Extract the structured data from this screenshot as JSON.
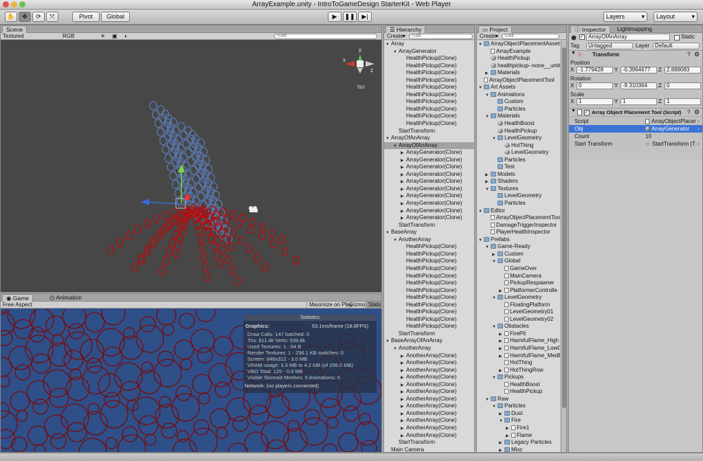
{
  "window": {
    "title": "ArrayExample.unity - IntroToGameDesign StarterKit - Web Player"
  },
  "toolbar": {
    "pivot": "Pivot",
    "global": "Global",
    "layers": "Layers",
    "layout": "Layout"
  },
  "scene": {
    "tab": "Scene",
    "shading": "Textured",
    "render": "RGB",
    "iso": "Iso",
    "axis_y": "y",
    "axis_x": "x",
    "axis_z": "z"
  },
  "game": {
    "tab": "Game",
    "tab2": "Animation",
    "aspect": "Free Aspect",
    "maximize": "Maximize on Play",
    "gizmos": "Gizmos",
    "stats": "Stats"
  },
  "stats": {
    "title": "Statistics",
    "graphics": "Graphics:",
    "frame": "53.1ms/frame (18.8FPS)",
    "lines": [
      "Draw Calls: 147  batched: 0",
      "Tris: 811.4k   Verts: 539.8k",
      "Used Textures: 1 - 64 B",
      "Render Textures: 1 - 256.1 KB  switches: 0",
      "Screen: 846x312 - 3.0 MB",
      "VRAM usage: 3.3 MB to 4.2 MB (of 256.0 MB)",
      "VBO Total: 125 - 0.9 MB",
      "Visible Skinned Meshes: 0     Animations: 0"
    ],
    "network": "Network: (no players connected)"
  },
  "hierarchy": {
    "tab": "Hierarchy",
    "create": "Create",
    "rows": [
      {
        "t": "Array",
        "d": 0,
        "a": "▼"
      },
      {
        "t": "ArrayGenerator",
        "d": 1,
        "a": "▼"
      },
      {
        "t": "HealthPickup(Clone)",
        "d": 2,
        "a": ""
      },
      {
        "t": "HealthPickup(Clone)",
        "d": 2,
        "a": ""
      },
      {
        "t": "HealthPickup(Clone)",
        "d": 2,
        "a": ""
      },
      {
        "t": "HealthPickup(Clone)",
        "d": 2,
        "a": ""
      },
      {
        "t": "HealthPickup(Clone)",
        "d": 2,
        "a": ""
      },
      {
        "t": "HealthPickup(Clone)",
        "d": 2,
        "a": ""
      },
      {
        "t": "HealthPickup(Clone)",
        "d": 2,
        "a": ""
      },
      {
        "t": "HealthPickup(Clone)",
        "d": 2,
        "a": ""
      },
      {
        "t": "HealthPickup(Clone)",
        "d": 2,
        "a": ""
      },
      {
        "t": "HealthPickup(Clone)",
        "d": 2,
        "a": ""
      },
      {
        "t": "StartTransform",
        "d": 1,
        "a": ""
      },
      {
        "t": "ArrayOfAnArray",
        "d": 0,
        "a": "▼"
      },
      {
        "t": "ArrayOfAnArray",
        "d": 1,
        "a": "▼",
        "sel": true
      },
      {
        "t": "ArrayGenerator(Clone)",
        "d": 2,
        "a": "▶"
      },
      {
        "t": "ArrayGenerator(Clone)",
        "d": 2,
        "a": "▶"
      },
      {
        "t": "ArrayGenerator(Clone)",
        "d": 2,
        "a": "▶"
      },
      {
        "t": "ArrayGenerator(Clone)",
        "d": 2,
        "a": "▶"
      },
      {
        "t": "ArrayGenerator(Clone)",
        "d": 2,
        "a": "▶"
      },
      {
        "t": "ArrayGenerator(Clone)",
        "d": 2,
        "a": "▶"
      },
      {
        "t": "ArrayGenerator(Clone)",
        "d": 2,
        "a": "▶"
      },
      {
        "t": "ArrayGenerator(Clone)",
        "d": 2,
        "a": "▶"
      },
      {
        "t": "ArrayGenerator(Clone)",
        "d": 2,
        "a": "▶"
      },
      {
        "t": "ArrayGenerator(Clone)",
        "d": 2,
        "a": "▶"
      },
      {
        "t": "StartTransform",
        "d": 1,
        "a": ""
      },
      {
        "t": "BaseArray",
        "d": 0,
        "a": "▼"
      },
      {
        "t": "AnotherArray",
        "d": 1,
        "a": "▼"
      },
      {
        "t": "HealthPickup(Clone)",
        "d": 2,
        "a": ""
      },
      {
        "t": "HealthPickup(Clone)",
        "d": 2,
        "a": ""
      },
      {
        "t": "HealthPickup(Clone)",
        "d": 2,
        "a": ""
      },
      {
        "t": "HealthPickup(Clone)",
        "d": 2,
        "a": ""
      },
      {
        "t": "HealthPickup(Clone)",
        "d": 2,
        "a": ""
      },
      {
        "t": "HealthPickup(Clone)",
        "d": 2,
        "a": ""
      },
      {
        "t": "HealthPickup(Clone)",
        "d": 2,
        "a": ""
      },
      {
        "t": "HealthPickup(Clone)",
        "d": 2,
        "a": ""
      },
      {
        "t": "HealthPickup(Clone)",
        "d": 2,
        "a": ""
      },
      {
        "t": "HealthPickup(Clone)",
        "d": 2,
        "a": ""
      },
      {
        "t": "HealthPickup(Clone)",
        "d": 2,
        "a": ""
      },
      {
        "t": "HealthPickup(Clone)",
        "d": 2,
        "a": ""
      },
      {
        "t": "StartTransform",
        "d": 1,
        "a": ""
      },
      {
        "t": "BaseArrayOfAnArray",
        "d": 0,
        "a": "▼"
      },
      {
        "t": "AnotherArray",
        "d": 1,
        "a": "▼"
      },
      {
        "t": "AnotherArray(Clone)",
        "d": 2,
        "a": "▶"
      },
      {
        "t": "AnotherArray(Clone)",
        "d": 2,
        "a": "▶"
      },
      {
        "t": "AnotherArray(Clone)",
        "d": 2,
        "a": "▶"
      },
      {
        "t": "AnotherArray(Clone)",
        "d": 2,
        "a": "▶"
      },
      {
        "t": "AnotherArray(Clone)",
        "d": 2,
        "a": "▶"
      },
      {
        "t": "AnotherArray(Clone)",
        "d": 2,
        "a": "▶"
      },
      {
        "t": "AnotherArray(Clone)",
        "d": 2,
        "a": "▶"
      },
      {
        "t": "AnotherArray(Clone)",
        "d": 2,
        "a": "▶"
      },
      {
        "t": "AnotherArray(Clone)",
        "d": 2,
        "a": "▶"
      },
      {
        "t": "AnotherArray(Clone)",
        "d": 2,
        "a": "▶"
      },
      {
        "t": "AnotherArray(Clone)",
        "d": 2,
        "a": "▶"
      },
      {
        "t": "AnotherArray(Clone)",
        "d": 2,
        "a": "▶"
      },
      {
        "t": "StartTransform",
        "d": 1,
        "a": ""
      },
      {
        "t": "Main Camera",
        "d": 0,
        "a": ""
      }
    ]
  },
  "project": {
    "tab": "Project",
    "create": "Create",
    "rows": [
      {
        "t": "ArrayObjectPlacementAssets",
        "d": 0,
        "a": "▼",
        "i": "folder"
      },
      {
        "t": "ArrayExample",
        "d": 1,
        "a": "",
        "i": "file"
      },
      {
        "t": "HealthPickup",
        "d": 1,
        "a": "",
        "i": "sphere"
      },
      {
        "t": "healthpickup--none__untit",
        "d": 1,
        "a": "",
        "i": "sphere"
      },
      {
        "t": "Materials",
        "d": 1,
        "a": "▶",
        "i": "folder"
      },
      {
        "t": "ArrayObjectPlacementTool",
        "d": 0,
        "a": "",
        "i": "file"
      },
      {
        "t": "Art Assets",
        "d": 0,
        "a": "▼",
        "i": "folder"
      },
      {
        "t": "Animations",
        "d": 1,
        "a": "▼",
        "i": "folder"
      },
      {
        "t": "Custom",
        "d": 2,
        "a": "",
        "i": "folder"
      },
      {
        "t": "Particles",
        "d": 2,
        "a": "",
        "i": "folder"
      },
      {
        "t": "Materials",
        "d": 1,
        "a": "▼",
        "i": "folder"
      },
      {
        "t": "HealthBoost",
        "d": 2,
        "a": "",
        "i": "sphere"
      },
      {
        "t": "HealthPickup",
        "d": 2,
        "a": "",
        "i": "sphere"
      },
      {
        "t": "LevelGeometry",
        "d": 2,
        "a": "▼",
        "i": "folder"
      },
      {
        "t": "HotThing",
        "d": 3,
        "a": "",
        "i": "sphere"
      },
      {
        "t": "LevelGeometry",
        "d": 3,
        "a": "",
        "i": "sphere"
      },
      {
        "t": "Particles",
        "d": 2,
        "a": "",
        "i": "folder"
      },
      {
        "t": "Test",
        "d": 2,
        "a": "",
        "i": "folder"
      },
      {
        "t": "Models",
        "d": 1,
        "a": "▶",
        "i": "folder"
      },
      {
        "t": "Shaders",
        "d": 1,
        "a": "▶",
        "i": "folder"
      },
      {
        "t": "Textures",
        "d": 1,
        "a": "▼",
        "i": "folder"
      },
      {
        "t": "LevelGeometry",
        "d": 2,
        "a": "",
        "i": "folder"
      },
      {
        "t": "Particles",
        "d": 2,
        "a": "",
        "i": "folder"
      },
      {
        "t": "Editor",
        "d": 0,
        "a": "▼",
        "i": "folder"
      },
      {
        "t": "ArrayObjectPlacementToo",
        "d": 1,
        "a": "",
        "i": "file"
      },
      {
        "t": "DamageTriggerInspector",
        "d": 1,
        "a": "",
        "i": "file"
      },
      {
        "t": "PlayerHealthInspector",
        "d": 1,
        "a": "",
        "i": "file"
      },
      {
        "t": "Prefabs",
        "d": 0,
        "a": "▼",
        "i": "folder"
      },
      {
        "t": "Game-Ready",
        "d": 1,
        "a": "▼",
        "i": "folder"
      },
      {
        "t": "Custom",
        "d": 2,
        "a": "▶",
        "i": "folder"
      },
      {
        "t": "Global",
        "d": 2,
        "a": "▼",
        "i": "folder"
      },
      {
        "t": "GameOver",
        "d": 3,
        "a": "",
        "i": "file"
      },
      {
        "t": "MainCamera",
        "d": 3,
        "a": "",
        "i": "file"
      },
      {
        "t": "PickupRespawner",
        "d": 3,
        "a": "",
        "i": "file"
      },
      {
        "t": "PlatformerControlle",
        "d": 3,
        "a": "▶",
        "i": "file"
      },
      {
        "t": "LevelGeometry",
        "d": 2,
        "a": "▼",
        "i": "folder"
      },
      {
        "t": "FloatingPlatform",
        "d": 3,
        "a": "",
        "i": "file"
      },
      {
        "t": "LevelGeometry01",
        "d": 3,
        "a": "",
        "i": "file"
      },
      {
        "t": "LevelGeometry02",
        "d": 3,
        "a": "",
        "i": "file"
      },
      {
        "t": "Obstacles",
        "d": 2,
        "a": "▼",
        "i": "folder"
      },
      {
        "t": "FirePit",
        "d": 3,
        "a": "▶",
        "i": "file"
      },
      {
        "t": "HarmfulFlame_High",
        "d": 3,
        "a": "▶",
        "i": "file"
      },
      {
        "t": "HarmfulFlame_LowC",
        "d": 3,
        "a": "▶",
        "i": "file"
      },
      {
        "t": "HarmfulFlame_MedE",
        "d": 3,
        "a": "▶",
        "i": "file"
      },
      {
        "t": "HotThing",
        "d": 3,
        "a": "",
        "i": "file"
      },
      {
        "t": "HotThingRow",
        "d": 3,
        "a": "▶",
        "i": "file"
      },
      {
        "t": "Pickups",
        "d": 2,
        "a": "▼",
        "i": "folder"
      },
      {
        "t": "HealthBoost",
        "d": 3,
        "a": "",
        "i": "file"
      },
      {
        "t": "HealthPickup",
        "d": 3,
        "a": "",
        "i": "file"
      },
      {
        "t": "Raw",
        "d": 1,
        "a": "▼",
        "i": "folder"
      },
      {
        "t": "Particles",
        "d": 2,
        "a": "▼",
        "i": "folder"
      },
      {
        "t": "Dust",
        "d": 3,
        "a": "▶",
        "i": "folder"
      },
      {
        "t": "Fire",
        "d": 3,
        "a": "▼",
        "i": "folder"
      },
      {
        "t": "Fire1",
        "d": 4,
        "a": "▶",
        "i": "file"
      },
      {
        "t": "Flame",
        "d": 4,
        "a": "▶",
        "i": "file"
      },
      {
        "t": "Legacy Particles",
        "d": 3,
        "a": "▶",
        "i": "folder"
      },
      {
        "t": "Misc",
        "d": 3,
        "a": "▶",
        "i": "folder"
      }
    ]
  },
  "inspector": {
    "tab": "Inspector",
    "tab2": "Lightmapping",
    "object_name": "ArrayOfAnArray",
    "static": "Static",
    "tag_label": "Tag",
    "tag": "Untagged",
    "layer_label": "Layer",
    "layer": "Default",
    "transform": {
      "title": "Transform",
      "position": "Position",
      "rotation": "Rotation",
      "scale": "Scale",
      "pos": [
        "-1.779428",
        "-0.3964677",
        "2.888083"
      ],
      "rot": [
        "0",
        "-9.310364",
        "0"
      ],
      "scl": [
        "1",
        "1",
        "1"
      ]
    },
    "script_comp": {
      "title": "Array Object Placement Tool (Script)",
      "script_label": "Script",
      "script_value": "ArrayObjectPlacer",
      "obj_label": "Obj",
      "obj_value": "ArrayGenerator",
      "count_label": "Count",
      "count_value": "10",
      "start_label": "Start Transform",
      "start_value": "StartTransform (T"
    }
  },
  "colors": {
    "scene_bg": "#474747",
    "game_bg": "#2e4f88",
    "blue_objects": "#5a78b0",
    "red_objects": "#b50d0d",
    "selection": "#3a72d6"
  }
}
